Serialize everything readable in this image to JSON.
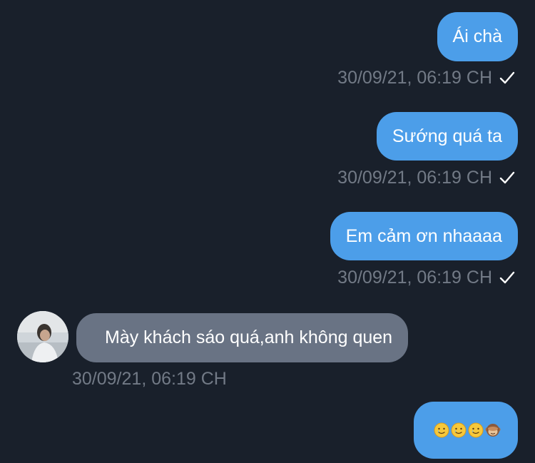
{
  "messages": [
    {
      "direction": "outgoing",
      "text": "Ái chà",
      "timestamp": "30/09/21, 06:19 CH",
      "status": "sent-check-icon"
    },
    {
      "direction": "outgoing",
      "text": "Sướng quá ta",
      "timestamp": "30/09/21, 06:19 CH",
      "status": "sent-check-icon"
    },
    {
      "direction": "outgoing",
      "text": "Em cảm ơn nhaaaa",
      "timestamp": "30/09/21, 06:19 CH",
      "status": "sent-check-icon"
    },
    {
      "direction": "incoming",
      "text": "Mày khách sáo quá,anh không quen",
      "timestamp": "30/09/21, 06:19 CH",
      "avatar": "avatar-photo"
    },
    {
      "direction": "outgoing",
      "emojis": [
        "smiling-face-with-tear-icon",
        "smiling-face-with-tear-icon",
        "smiling-face-with-tear-icon",
        "see-no-evil-monkey-icon"
      ]
    }
  ],
  "colors": {
    "background": "#19202b",
    "outgoing_bubble": "#4c9ee9",
    "incoming_bubble": "#697384",
    "timestamp_text": "#727a86"
  }
}
